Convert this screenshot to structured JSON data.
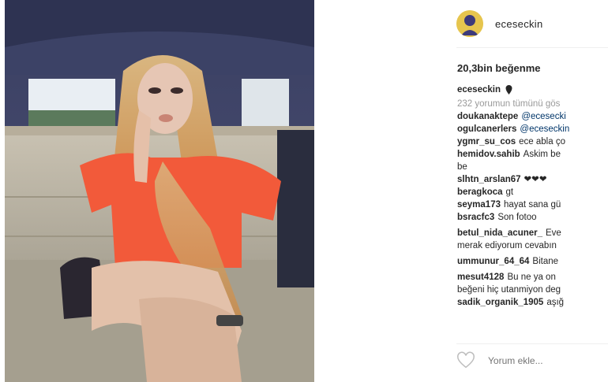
{
  "post": {
    "username": "eceseckin",
    "likes": "20,3bin beğenme",
    "caption_user": "eceseckin",
    "view_all": "232 yorumun tümünü gös",
    "comments": [
      {
        "user": "doukanaktepe",
        "mention": "@ecesecki",
        "text": ""
      },
      {
        "user": "ogulcanerlers",
        "mention": "@eceseckin",
        "text": ""
      },
      {
        "user": "ygmr_su_cos",
        "mention": "",
        "text": "ece abla ço"
      },
      {
        "user": "hemidov.sahib",
        "mention": "",
        "text": "Askim be",
        "text2": "be"
      },
      {
        "user": "slhtn_arslan67",
        "mention": "",
        "text": "❤❤❤"
      },
      {
        "user": "beragkoca",
        "mention": "",
        "text": "gt"
      },
      {
        "user": "seyma173",
        "mention": "",
        "text": "hayat sana gü"
      },
      {
        "user": "bsracfc3",
        "mention": "",
        "text": "Son fotoo"
      },
      {
        "user": "betul_nida_acuner_",
        "mention": "",
        "text": "Eve",
        "text2": "merak ediyorum cevabın"
      },
      {
        "user": "ummunur_64_64",
        "mention": "",
        "text": "Bitane"
      },
      {
        "user": "mesut4128",
        "mention": "",
        "text": "Bu ne ya on",
        "text2": "beğeni hiç utanmiyon deg"
      },
      {
        "user": "sadik_organik_1905",
        "mention": "",
        "text": "aşığ"
      }
    ],
    "comment_placeholder": "Yorum ekle..."
  },
  "icons": {
    "like": "heart-icon",
    "caption_badge": "pin-icon"
  }
}
